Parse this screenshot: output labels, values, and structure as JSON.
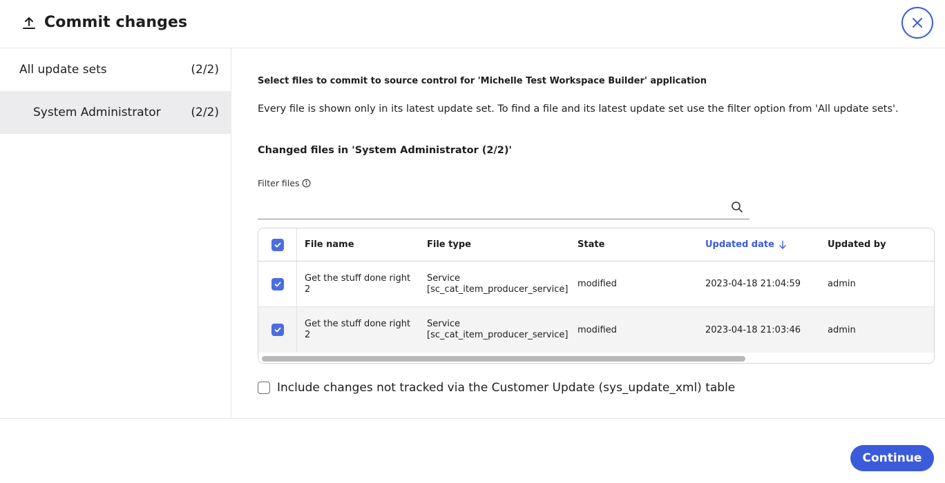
{
  "header": {
    "title": "Commit changes",
    "icon": "upload-icon",
    "close_icon": "close-icon"
  },
  "sidebar": {
    "items": [
      {
        "label": "All update sets",
        "count": "(2/2)"
      },
      {
        "label": "System Administrator",
        "count": "(2/2)",
        "selected": true
      }
    ]
  },
  "main": {
    "intro_title": "Select files to commit to source control for 'Michelle Test Workspace Builder' application",
    "intro_text": "Every file is shown only in its latest update set. To find a file and its latest update set use the filter option from 'All update sets'.",
    "changed_title": "Changed files in 'System Administrator (2/2)'",
    "filter": {
      "label": "Filter files",
      "value": "",
      "placeholder": ""
    },
    "table": {
      "columns": [
        "File name",
        "File type",
        "State",
        "Updated date",
        "Updated by"
      ],
      "sort_column": "Updated date",
      "sort_direction": "descending",
      "rows": [
        {
          "checked": true,
          "file_name_1": "Get the stuff done right",
          "file_name_2": "2",
          "file_type_1": "Service",
          "file_type_2": "[sc_cat_item_producer_service]",
          "state": "modified",
          "updated_date": "2023-04-18 21:04:59",
          "updated_by": "admin"
        },
        {
          "checked": true,
          "file_name_1": "Get the stuff done right",
          "file_name_2": "2",
          "file_type_1": "Service",
          "file_type_2": "[sc_cat_item_producer_service]",
          "state": "modified",
          "updated_date": "2023-04-18 21:03:46",
          "updated_by": "admin"
        }
      ]
    },
    "include_option": {
      "label": "Include changes not tracked via the Customer Update (sys_update_xml) table",
      "checked": false
    }
  },
  "footer": {
    "continue_label": "Continue"
  },
  "colors": {
    "accent": "#3b5bdb",
    "checkbox": "#4a6ee0",
    "selected_bg": "#ececee"
  }
}
